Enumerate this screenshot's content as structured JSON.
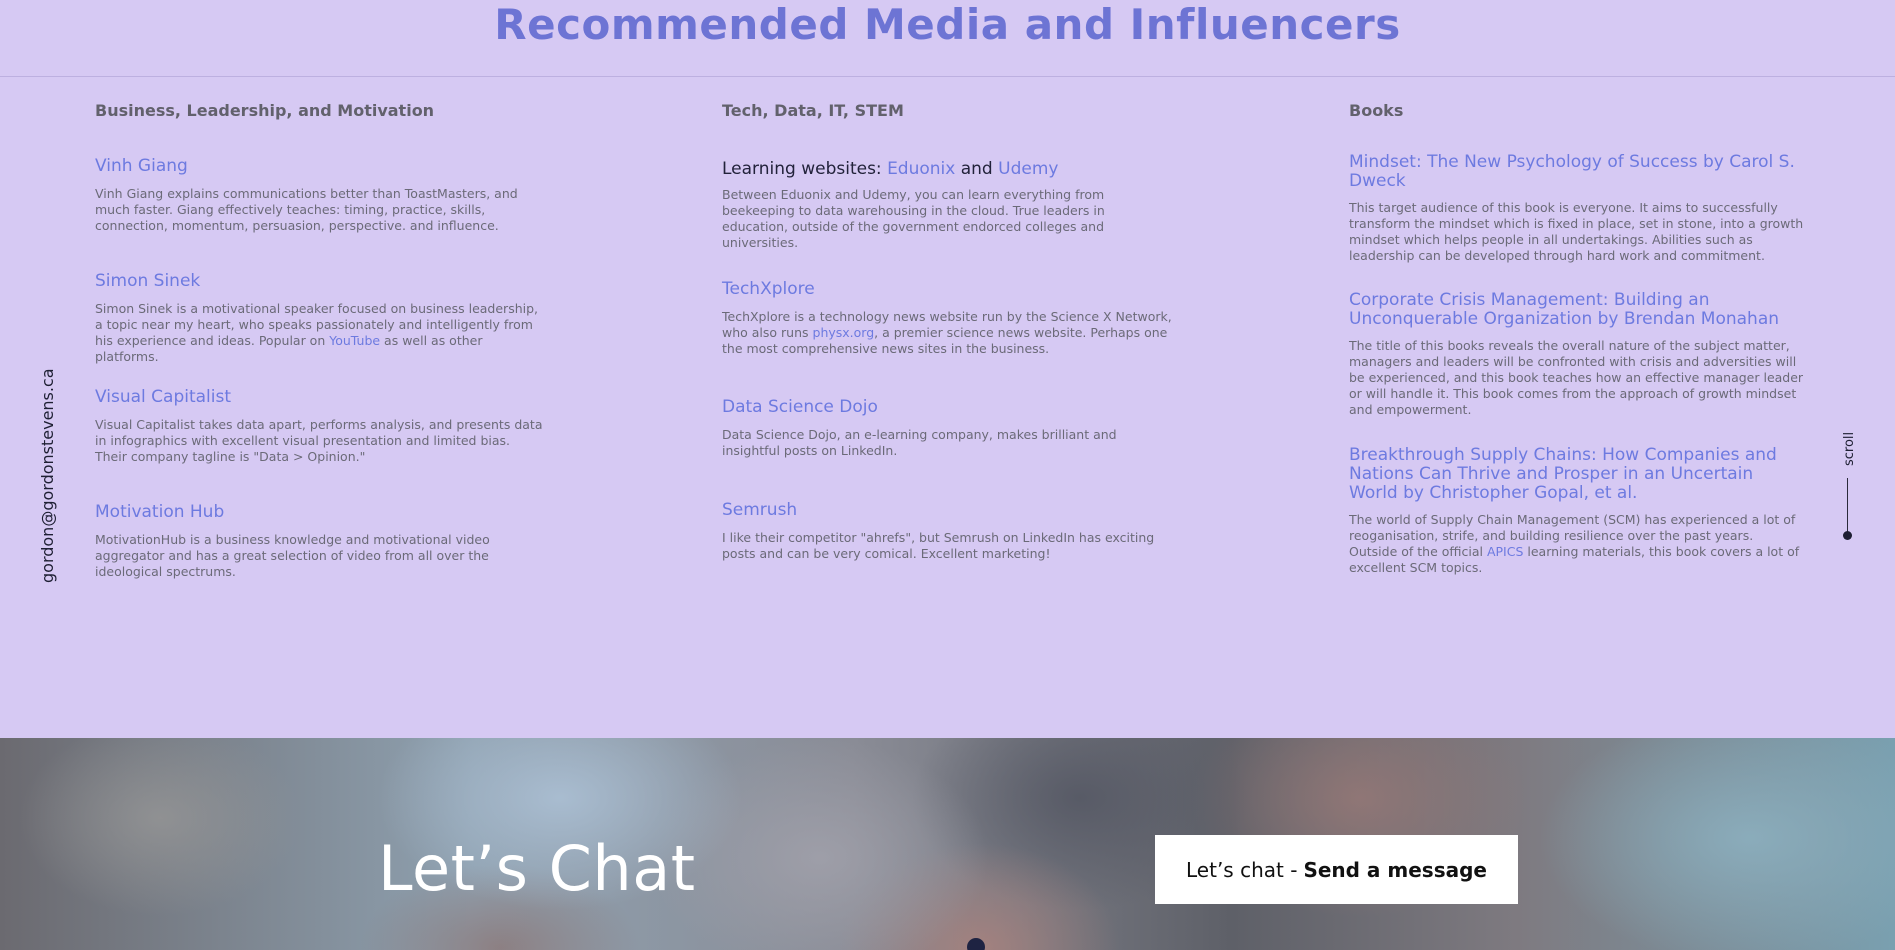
{
  "page_title": "Recommended Media and Influencers",
  "side_email": "gordon@gordonstevens.ca",
  "scroll_label": "scroll",
  "columns": [
    {
      "heading": "Business, Leadership, and Motivation",
      "entries": [
        {
          "title": "Vinh Giang",
          "desc": "Vinh Giang explains communications better than ToastMasters, and much faster. Giang effectively teaches: timing, practice, skills, connection, momentum, persuasion, perspective. and influence."
        },
        {
          "title": "Simon Sinek",
          "desc_before": "Simon Sinek is a motivational speaker focused on business leadership, a topic near my heart, who speaks passionately and intelligently from his experience and ideas. Popular on ",
          "desc_link": "YouTube",
          "desc_after": " as well as other platforms."
        },
        {
          "title": "Visual Capitalist",
          "desc": "Visual Capitalist takes data apart, performs analysis, and presents data in infographics with excellent visual presentation and limited bias. Their company tagline is \"Data > Opinion.\""
        },
        {
          "title": "Motivation Hub",
          "desc": "MotivationHub is a business knowledge and motivational video aggregator and has a great selection of video from all over the ideological spectrums."
        }
      ]
    },
    {
      "heading": "Tech, Data, IT, STEM",
      "entries": [
        {
          "title_prefix": "Learning websites: ",
          "title_link_1": "Eduonix",
          "title_mid": " and ",
          "title_link_2": "Udemy",
          "desc": "Between Eduonix and Udemy, you can learn everything from beekeeping to data warehousing in the cloud. True leaders in education, outside of the government endorced colleges and universities."
        },
        {
          "title": "TechXplore",
          "desc_before": "TechXplore is a technology news website run by the Science X Network, who also runs ",
          "desc_link": "physx.org",
          "desc_after": ", a premier science news website. Perhaps one the most comprehensive news sites in the business."
        },
        {
          "title": "Data Science Dojo",
          "desc": "Data Science Dojo, an e-learning company, makes brilliant and insightful posts on LinkedIn."
        },
        {
          "title": "Semrush",
          "desc": "I like their competitor \"ahrefs\", but Semrush on LinkedIn has exciting posts and can be very comical. Excellent marketing!"
        }
      ]
    },
    {
      "heading": "Books",
      "entries": [
        {
          "title": "Mindset: The New Psychology of Success by Carol S. Dweck",
          "desc": "This target audience of this book is everyone. It aims to successfully transform the mindset which is fixed in place, set in stone, into a growth mindset which helps people in all undertakings. Abilities such as leadership can be developed through hard work and commitment."
        },
        {
          "title": "Corporate Crisis Management: Building an Unconquerable Organization by Brendan Monahan",
          "desc": "The title of this books reveals the overall nature of the subject matter, managers and leaders will be confronted with crisis and adversities will be experienced, and this book teaches how an effective manager leader or will handle it. This book comes from the approach of growth mindset and empowerment."
        },
        {
          "title": "Breakthrough Supply Chains: How Companies and Nations Can Thrive and Prosper in an Uncertain World by Christopher Gopal, et al.",
          "desc_before": "The world of Supply Chain Management (SCM) has experienced a lot of reoganisation, strife, and building resilience over the past years. Outside of the official ",
          "desc_link": "APICS",
          "desc_after": " learning materials, this book covers a lot of excellent SCM topics."
        }
      ]
    }
  ],
  "chat": {
    "title": "Let’s Chat",
    "button_prefix": "Let’s chat -",
    "button_bold": "Send a message"
  }
}
